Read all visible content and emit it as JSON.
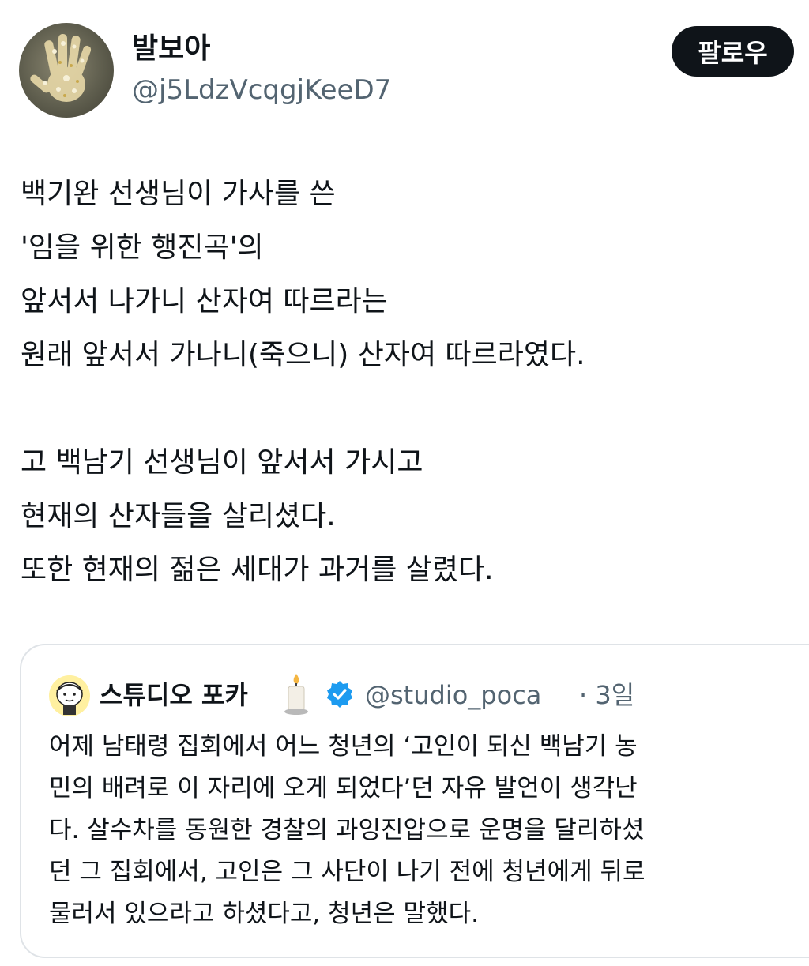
{
  "author": {
    "display_name": "발보아",
    "handle": "@j5LdzVcqgjKeeD7",
    "avatar_icon": "handprint-avatar-icon"
  },
  "follow_label": "팔로우",
  "tweet": {
    "lines": [
      "백기완 선생님이 가사를 쓴",
      "'임을 위한 행진곡'의",
      "앞서서 나가니 산자여 따르라는",
      "원래 앞서서 가나니(죽으니) 산자여 따르라였다.",
      "",
      "고 백남기 선생님이 앞서서 가시고",
      "현재의 산자들을 살리셨다.",
      "또한 현재의 젊은 세대가 과거를 살렸다."
    ]
  },
  "quote": {
    "display_name": "스튜디오 포카",
    "name_icon": "candle-icon",
    "verified_icon": "verified-badge-icon",
    "handle": "@studio_poca",
    "time": "· 3일",
    "lines": [
      "어제 남태령 집회에서 어느 청년의 ‘고인이 되신 백남기 농",
      "민의 배려로 이 자리에 오게 되었다’던 자유 발언이 생각난",
      "다. 살수차를 동원한 경찰의 과잉진압으로 운명을 달리하셨",
      "던 그 집회에서, 고인은 그 사단이 나기 전에 청년에게 뒤로",
      "물러서 있으라고 하셨다고, 청년은 말했다."
    ]
  },
  "colors": {
    "text": "#0f1419",
    "secondary": "#536471",
    "button_bg": "#0f1419",
    "verified": "#1d9bf0",
    "border": "#dfe3e7"
  }
}
